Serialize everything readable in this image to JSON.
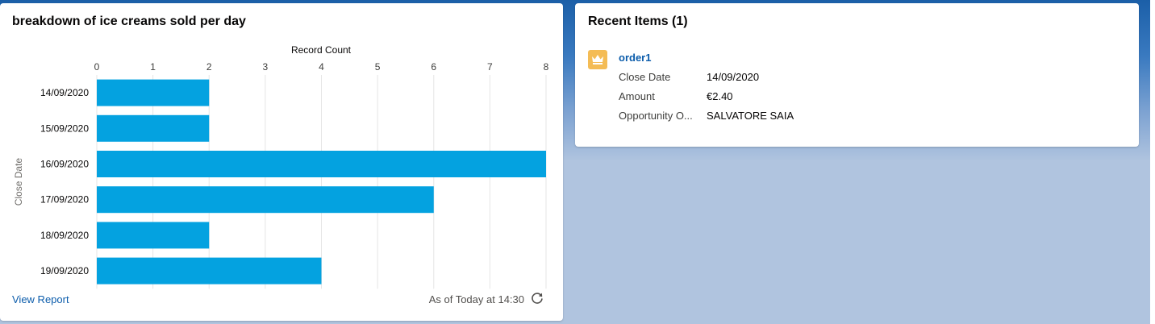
{
  "colors": {
    "bar": "#04a2e0",
    "link": "#0b5cab",
    "grid": "#e5e5e5",
    "item_icon": "#f4bc55"
  },
  "chart_card": {
    "title": "breakdown of ice creams sold per day",
    "view_report": "View Report",
    "as_of": "As of Today at 14:30",
    "refresh_icon": "refresh-icon"
  },
  "chart_data": {
    "type": "bar",
    "orientation": "horizontal",
    "title": "breakdown of ice creams sold per day",
    "xlabel": "Record Count",
    "ylabel": "Close Date",
    "categories": [
      "14/09/2020",
      "15/09/2020",
      "16/09/2020",
      "17/09/2020",
      "18/09/2020",
      "19/09/2020"
    ],
    "values": [
      2,
      2,
      8,
      6,
      2,
      4
    ],
    "xlim": [
      0,
      8
    ],
    "xticks": [
      0,
      1,
      2,
      3,
      4,
      5,
      6,
      7,
      8
    ],
    "axis_position": "top",
    "grid": true
  },
  "recent_items": {
    "title": "Recent Items (1)",
    "items": [
      {
        "icon": "crown-icon",
        "name": "order1",
        "fields": [
          {
            "label": "Close Date",
            "value": "14/09/2020"
          },
          {
            "label": "Amount",
            "value": "€2.40"
          },
          {
            "label": "Opportunity O...",
            "value": "SALVATORE SAIA"
          }
        ]
      }
    ]
  }
}
